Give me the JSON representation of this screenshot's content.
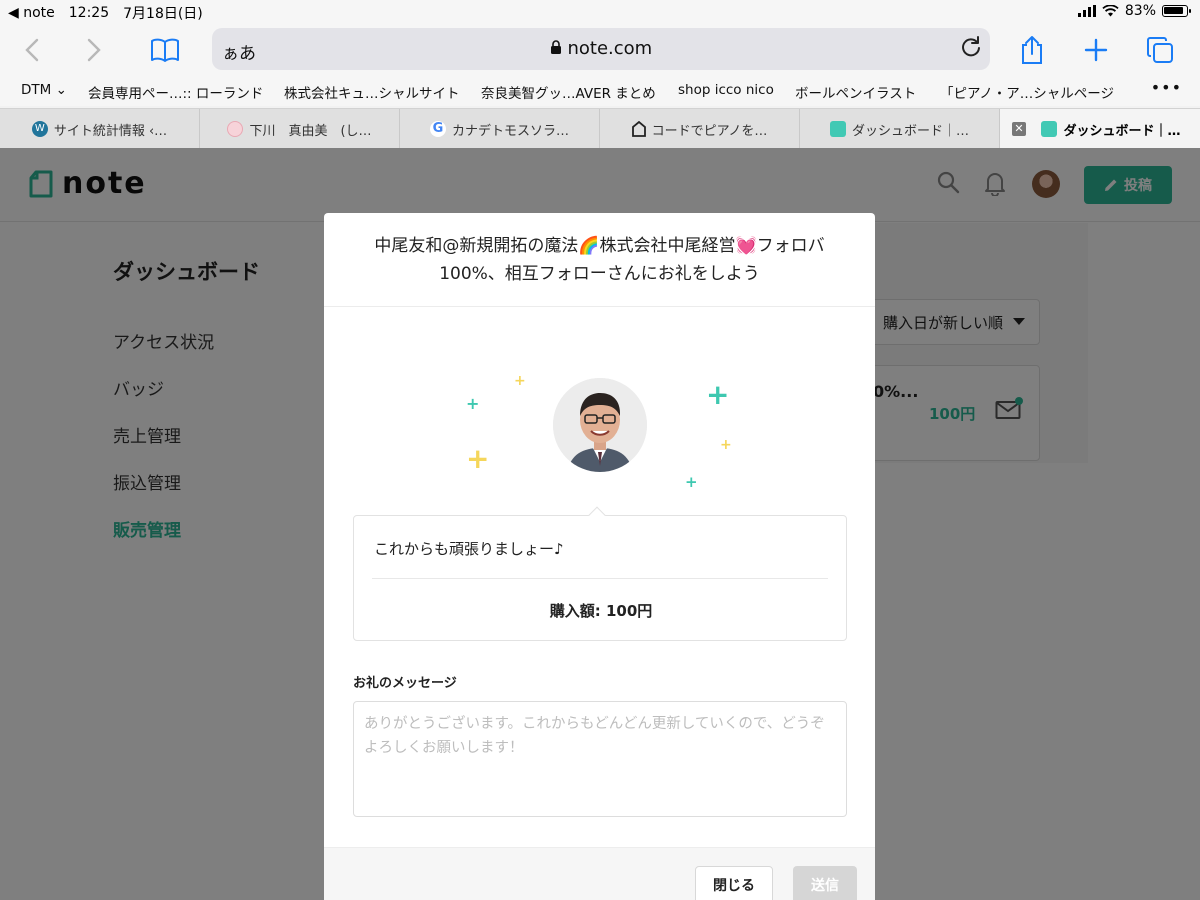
{
  "status_bar": {
    "back_app": "note",
    "time": "12:25",
    "date": "7月18日(日)",
    "battery": "83%"
  },
  "browser": {
    "address_aa": "ぁあ",
    "url": "note.com",
    "accent": "#1a7cf5"
  },
  "bookmarks": [
    {
      "label": "DTM"
    },
    {
      "label": "会員専用ペー…:: ローランド"
    },
    {
      "label": "株式会社キュ…シャルサイト"
    },
    {
      "label": "奈良美智グッ…AVER まとめ"
    },
    {
      "label": "shop icco nico"
    },
    {
      "label": "ボールペンイラスト"
    },
    {
      "label": "「ピアノ・ア…シャルページ"
    }
  ],
  "bookmarks_more": "•••",
  "tabs": [
    {
      "label": "サイト統計情報 ‹…"
    },
    {
      "label": "下川　真由美　(し…"
    },
    {
      "label": "カナデトモスソラ…"
    },
    {
      "label": "コードでピアノを…"
    },
    {
      "label": "ダッシュボード｜…"
    },
    {
      "label": "ダッシュボード｜…"
    }
  ],
  "note": {
    "logo": "note",
    "brand_color": "#2cb696",
    "post_button": "投稿",
    "dashboard_title": "ダッシュボード",
    "sidebar": [
      {
        "label": "アクセス状況"
      },
      {
        "label": "バッジ"
      },
      {
        "label": "売上管理"
      },
      {
        "label": "振込管理"
      },
      {
        "label": "販売管理"
      }
    ],
    "sort_label": "購入日が新しい順",
    "order_title": "0%...",
    "order_price": "100円"
  },
  "modal": {
    "title_line1": "中尾友和@新規開拓の魔法🌈株式会社中尾経営💓フォロバ",
    "title_line2": "100%、相互フォローさんにお礼をしよう",
    "buyer_message": "これからも頑張りましょー♪",
    "amount": "購入額: 100円",
    "thanks_label": "お礼のメッセージ",
    "thanks_placeholder": "ありがとうございます。これからもどんどん更新していくので、どうぞよろしくお願いします！",
    "close_button": "閉じる",
    "send_button": "送信"
  }
}
